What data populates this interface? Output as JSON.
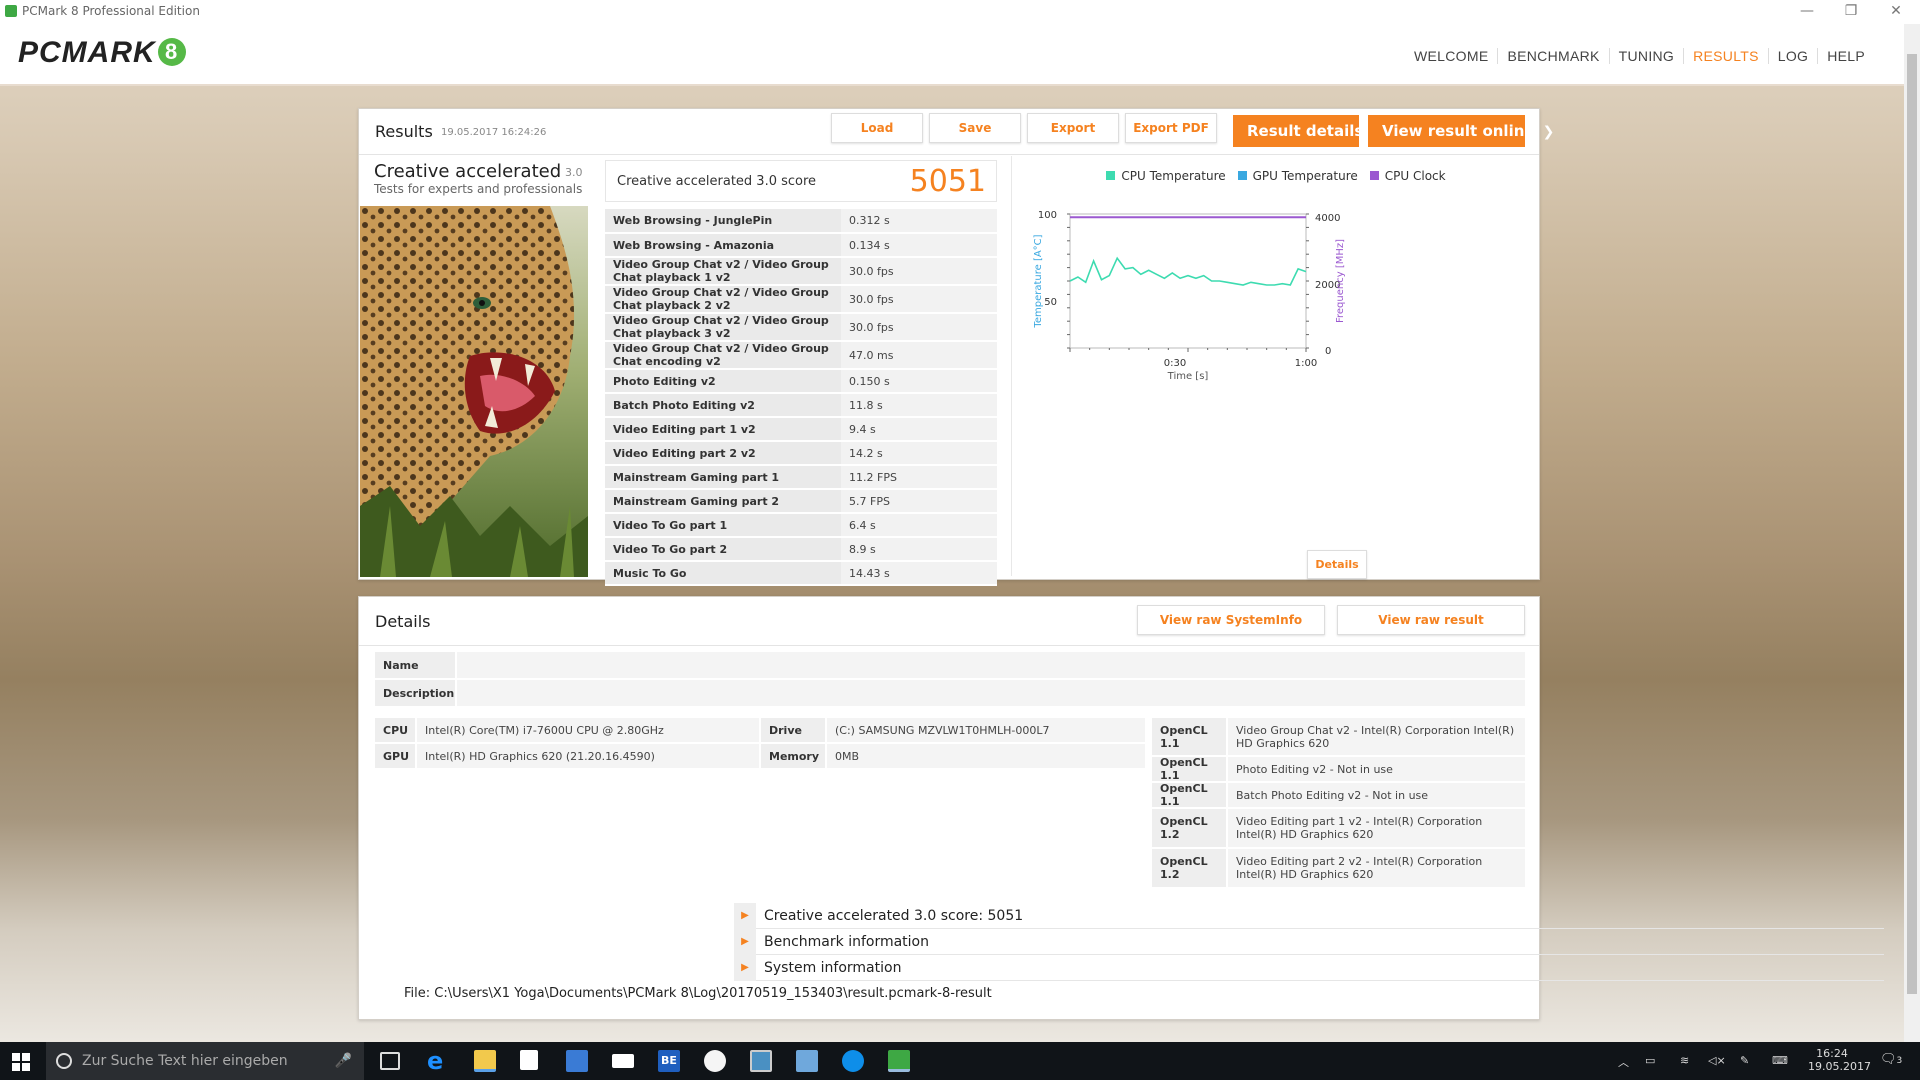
{
  "window": {
    "title": "PCMark 8 Professional Edition",
    "minimize": "—",
    "maximize": "❐",
    "close": "✕"
  },
  "logo": {
    "text": "PCMARK",
    "badge": "8"
  },
  "nav": {
    "items": [
      "WELCOME",
      "BENCHMARK",
      "TUNING",
      "RESULTS",
      "LOG",
      "HELP"
    ],
    "active": "RESULTS"
  },
  "results": {
    "title": "Results",
    "timestamp": "19.05.2017 16:24:26",
    "buttons": {
      "load": "Load",
      "save": "Save",
      "export": "Export",
      "export_pdf": "Export PDF",
      "result_details": "Result details",
      "view_online": "View result online"
    },
    "test_name": "Creative accelerated",
    "test_version": "3.0",
    "test_subtitle": "Tests for experts and professionals",
    "score_label": "Creative accelerated 3.0 score",
    "score": "5051",
    "rows": [
      {
        "name": "Web Browsing - JunglePin",
        "value": "0.312 s"
      },
      {
        "name": "Web Browsing - Amazonia",
        "value": "0.134 s"
      },
      {
        "name": "Video Group Chat v2 / Video Group Chat playback 1 v2",
        "value": "30.0 fps"
      },
      {
        "name": "Video Group Chat v2 / Video Group Chat playback 2 v2",
        "value": "30.0 fps"
      },
      {
        "name": "Video Group Chat v2 / Video Group Chat playback 3 v2",
        "value": "30.0 fps"
      },
      {
        "name": "Video Group Chat v2 / Video Group Chat encoding v2",
        "value": "47.0 ms"
      },
      {
        "name": "Photo Editing v2",
        "value": "0.150 s"
      },
      {
        "name": "Batch Photo Editing v2",
        "value": "11.8 s"
      },
      {
        "name": "Video Editing part 1 v2",
        "value": "9.4 s"
      },
      {
        "name": "Video Editing part 2 v2",
        "value": "14.2 s"
      },
      {
        "name": "Mainstream Gaming part 1",
        "value": "11.2 FPS"
      },
      {
        "name": "Mainstream Gaming part 2",
        "value": "5.7 FPS"
      },
      {
        "name": "Video To Go part 1",
        "value": "6.4 s"
      },
      {
        "name": "Video To Go part 2",
        "value": "8.9 s"
      },
      {
        "name": "Music To Go",
        "value": "14.43 s"
      }
    ],
    "details_button": "Details"
  },
  "monitor": {
    "legend": [
      {
        "name": "CPU Temperature",
        "color": "#3ddbb0"
      },
      {
        "name": "GPU Temperature",
        "color": "#3aa8e0"
      },
      {
        "name": "CPU Clock",
        "color": "#9b59d0"
      }
    ],
    "y_left_label": "Temperature [A°C]",
    "y_right_label": "Frequency [MHz]",
    "x_label": "Time [s]",
    "y_left_ticks": [
      "100",
      "50"
    ],
    "y_right_ticks": [
      "4000",
      "2000",
      "0"
    ],
    "x_ticks": [
      "0:30",
      "1:00"
    ]
  },
  "chart_data": {
    "type": "line",
    "xlabel": "Time [s]",
    "ylabel": "Temperature [A°C]",
    "ylim": [
      0,
      100
    ],
    "y2label": "Frequency [MHz]",
    "y2lim": [
      0,
      4000
    ],
    "xlim": [
      0,
      60
    ],
    "series": [
      {
        "name": "CPU Temperature",
        "axis": "left",
        "x": [
          0,
          2,
          4,
          6,
          8,
          10,
          12,
          14,
          16,
          18,
          20,
          22,
          24,
          26,
          28,
          30,
          32,
          34,
          36,
          38,
          40,
          42,
          44,
          46,
          48,
          50,
          52,
          54,
          56,
          58,
          60
        ],
        "values": [
          50,
          53,
          49,
          65,
          51,
          54,
          67,
          59,
          60,
          55,
          58,
          55,
          52,
          56,
          52,
          54,
          52,
          54,
          50,
          50,
          49,
          48,
          47,
          49,
          48,
          47,
          47,
          48,
          47,
          59,
          57
        ]
      },
      {
        "name": "CPU Clock",
        "axis": "right",
        "x": [
          0,
          60
        ],
        "values": [
          3900,
          3900
        ]
      }
    ]
  },
  "details": {
    "title": "Details",
    "btn_sysinfo": "View raw SystemInfo",
    "btn_raw": "View raw result",
    "name_label": "Name",
    "name_value": "",
    "desc_label": "Description",
    "desc_value": "",
    "cpu_label": "CPU",
    "cpu_value": "Intel(R) Core(TM) i7-7600U CPU @ 2.80GHz",
    "gpu_label": "GPU",
    "gpu_value": "Intel(R) HD Graphics 620 (21.20.16.4590)",
    "drive_label": "Drive",
    "drive_value": "(C:) SAMSUNG MZVLW1T0HMLH-000L7",
    "memory_label": "Memory",
    "memory_value": "0MB",
    "opencl": [
      {
        "label": "OpenCL 1.1",
        "value": "Video Group Chat v2 - Intel(R) Corporation Intel(R) HD Graphics 620"
      },
      {
        "label": "OpenCL 1.1",
        "value": "Photo Editing v2 - Not in use"
      },
      {
        "label": "OpenCL 1.1",
        "value": "Batch Photo Editing v2 - Not in use"
      },
      {
        "label": "OpenCL 1.2",
        "value": "Video Editing part 1 v2 - Intel(R) Corporation Intel(R) HD Graphics 620"
      },
      {
        "label": "OpenCL 1.2",
        "value": "Video Editing part 2 v2 - Intel(R) Corporation Intel(R) HD Graphics 620"
      }
    ],
    "expanders": [
      "Creative accelerated 3.0 score: 5051",
      "Benchmark information",
      "System information"
    ],
    "file": "File: C:\\Users\\X1 Yoga\\Documents\\PCMark 8\\Log\\20170519_153403\\result.pcmark-8-result"
  },
  "taskbar": {
    "search_placeholder": "Zur Suche Text hier eingeben",
    "time": "16:24",
    "date": "19.05.2017",
    "notif_count": "3",
    "icons": [
      "windows-start-icon",
      "microphone-icon",
      "task-view-icon",
      "edge-icon",
      "file-explorer-icon",
      "store-icon",
      "calculator-icon",
      "mail-icon",
      "be-app-icon",
      "paint-icon",
      "monitor-app-icon",
      "remote-desktop-icon",
      "teamviewer-icon",
      "pcmark-icon"
    ]
  }
}
